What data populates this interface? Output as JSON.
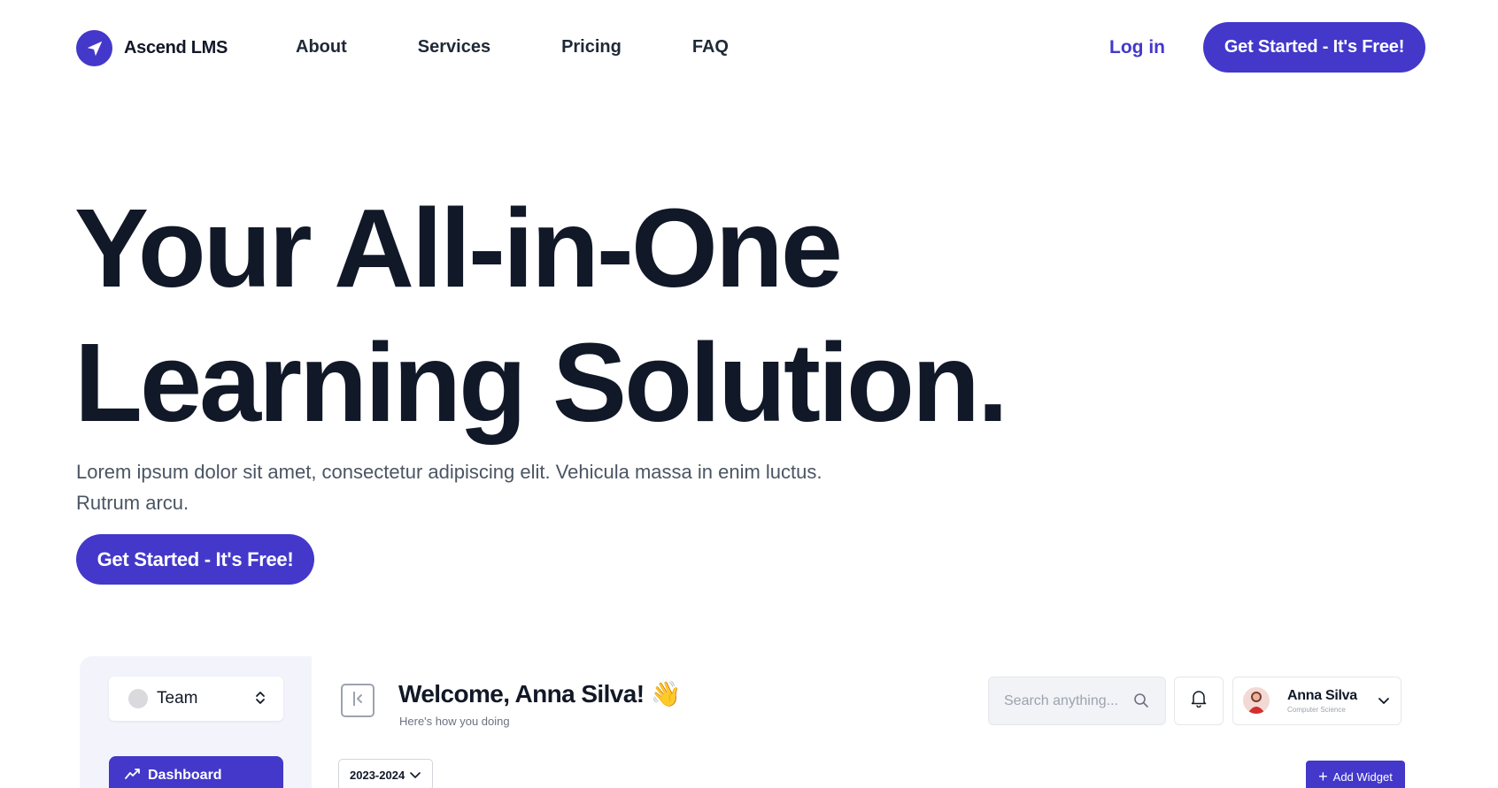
{
  "nav": {
    "brand": "Ascend LMS",
    "links": [
      "About",
      "Services",
      "Pricing",
      "FAQ"
    ],
    "login": "Log in",
    "cta": "Get Started - It's Free!"
  },
  "hero": {
    "title_line1": "Your All-in-One",
    "title_line2": "Learning Solution.",
    "subtitle_line1": "Lorem ipsum dolor sit amet, consectetur adipiscing elit. Vehicula massa in enim luctus.",
    "subtitle_line2": "Rutrum arcu.",
    "cta": "Get Started - It's Free!"
  },
  "preview": {
    "team_select": "Team",
    "dashboard": "Dashboard",
    "welcome": "Welcome, Anna Silva! 👋",
    "welcome_sub": "Here's how you doing",
    "year": "2023-2024",
    "search_placeholder": "Search anything...",
    "profile_name": "Anna Silva",
    "profile_role": "Computer Science",
    "add_widget": "Add Widget"
  },
  "colors": {
    "accent": "#4338ca",
    "text": "#111827",
    "muted": "#4b5563",
    "sidebar_bg": "#f3f4fb"
  }
}
